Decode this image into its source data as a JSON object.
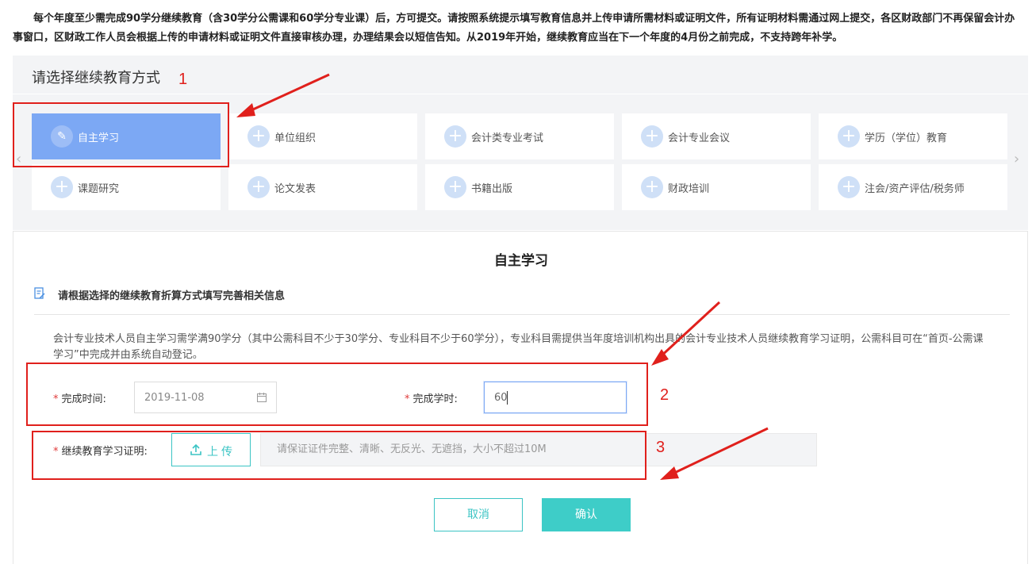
{
  "notice": "每个年度至少需完成90学分继续教育（含30学分公需课和60学分专业课）后，方可提交。请按照系统提示填写教育信息并上传申请所需材料或证明文件，所有证明材料需通过网上提交，各区财政部门不再保留会计办事窗口，区财政工作人员会根据上传的申请材料或证明文件直接审核办理，办理结果会以短信告知。从2019年开始，继续教育应当在下一个年度的4月份之前完成，不支持跨年补学。",
  "panel": {
    "title": "请选择继续教育方式",
    "nav_prev": "‹",
    "nav_next": "›",
    "methods": [
      {
        "label": "自主学习",
        "icon": "pencil-icon",
        "active": true
      },
      {
        "label": "单位组织",
        "icon": "plus-icon"
      },
      {
        "label": "会计类专业考试",
        "icon": "plus-icon"
      },
      {
        "label": "会计专业会议",
        "icon": "plus-icon"
      },
      {
        "label": "学历（学位）教育",
        "icon": "plus-icon"
      },
      {
        "label": "课题研究",
        "icon": "plus-icon"
      },
      {
        "label": "论文发表",
        "icon": "plus-icon"
      },
      {
        "label": "书籍出版",
        "icon": "plus-icon"
      },
      {
        "label": "财政培训",
        "icon": "plus-icon"
      },
      {
        "label": "注会/资产评估/税务师",
        "icon": "plus-icon"
      }
    ]
  },
  "form": {
    "title": "自主学习",
    "section_title": "请根据选择的继续教育折算方式填写完善相关信息",
    "description": "会计专业技术人员自主学习需学满90学分（其中公需科目不少于30学分、专业科目不少于60学分），专业科目需提供当年度培训机构出具的会计专业技术人员继续教育学习证明，公需科目可在“首页-公需课学习”中完成并由系统自动登记。",
    "required_mark": "*",
    "completion_time_label": "完成时间:",
    "completion_time_value": "2019-11-08",
    "completion_hours_label": "完成学时:",
    "completion_hours_value": "60",
    "certificate_label": "继续教育学习证明:",
    "upload_label": "上传",
    "upload_hint": "请保证证件完整、清晰、无反光、无遮挡，大小不超过10M",
    "cancel_label": "取消",
    "confirm_label": "确认"
  },
  "annotations": {
    "step1": "1",
    "step2": "2",
    "step3": "3",
    "color": "#e0201c"
  },
  "colors": {
    "active_method": "#7ca8f4",
    "accent_teal": "#3ecdc8",
    "panel_bg": "#f3f4f6"
  }
}
